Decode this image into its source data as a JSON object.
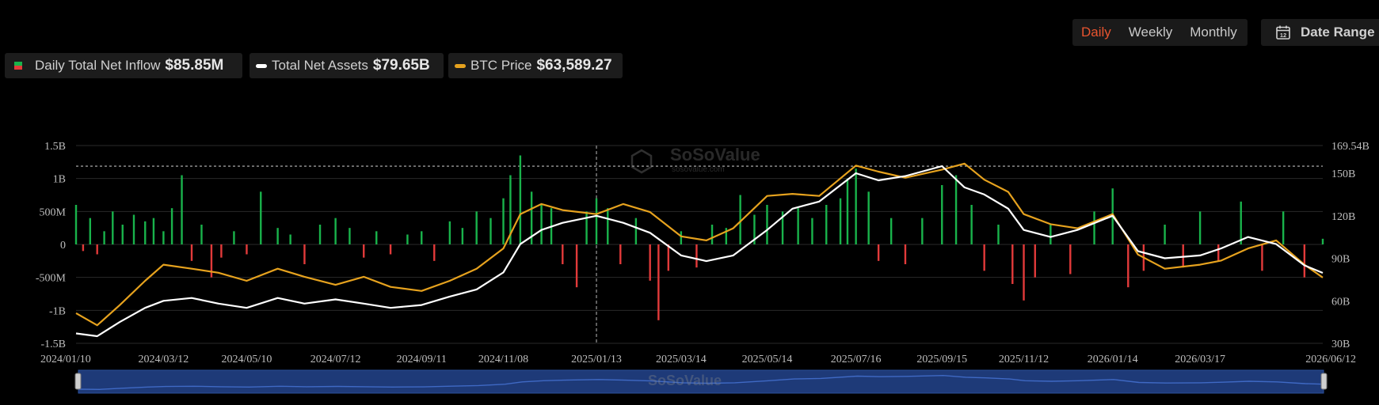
{
  "toolbar": {
    "period_options": [
      "Daily",
      "Weekly",
      "Monthly"
    ],
    "active_period": "Daily",
    "date_range_label": "Date Range",
    "date_range_icon": "calendar-icon"
  },
  "legend": {
    "inflow_label": "Daily Total Net Inflow",
    "inflow_value": "$85.85M",
    "assets_label": "Total Net Assets",
    "assets_value": "$79.65B",
    "btc_label": "BTC Price",
    "btc_value": "$63,589.27"
  },
  "watermark": {
    "text": "SoSoValue",
    "subtext": "sosovalue.com"
  },
  "colors": {
    "inflow_positive": "#19b34b",
    "inflow_negative": "#e23a3a",
    "assets_line": "#ffffff",
    "btc_line": "#e6a21e",
    "navigator": "#1e3a78",
    "active": "#e8542f"
  },
  "chart_data": {
    "type": "bar+line",
    "x_ticks": [
      "2024/01/10",
      "2024/03/12",
      "2024/05/10",
      "2024/07/12",
      "2024/09/11",
      "2024/11/08",
      "2025/01/13",
      "2025/03/14",
      "2025/05/14",
      "2025/07/16",
      "2025/09/15",
      "2025/11/12",
      "2026/01/14",
      "2026/03/17",
      "2026/06/12"
    ],
    "y_left_ticks": [
      "1.5B",
      "1B",
      "500M",
      "0",
      "-500M",
      "-1B",
      "-1.5B"
    ],
    "y_left_range": [
      -1500000000,
      1500000000
    ],
    "y_right_ticks": [
      "169.54B",
      "150B",
      "120B",
      "90B",
      "60B",
      "30B"
    ],
    "y_right_range": [
      30000000000,
      169540000000
    ],
    "crosshair_date": "2025/01/13",
    "reference_line": 155000000000,
    "series": [
      {
        "name": "Daily Total Net Inflow",
        "type": "bar",
        "x": [
          "2024/01/10",
          "2024/01/15",
          "2024/01/20",
          "2024/01/25",
          "2024/01/30",
          "2024/02/05",
          "2024/02/12",
          "2024/02/20",
          "2024/02/28",
          "2024/03/05",
          "2024/03/12",
          "2024/03/18",
          "2024/03/25",
          "2024/04/01",
          "2024/04/08",
          "2024/04/15",
          "2024/04/22",
          "2024/05/01",
          "2024/05/10",
          "2024/05/20",
          "2024/06/01",
          "2024/06/10",
          "2024/06/20",
          "2024/07/01",
          "2024/07/12",
          "2024/07/22",
          "2024/08/01",
          "2024/08/10",
          "2024/08/20",
          "2024/09/01",
          "2024/09/11",
          "2024/09/20",
          "2024/10/01",
          "2024/10/10",
          "2024/10/20",
          "2024/10/30",
          "2024/11/08",
          "2024/11/13",
          "2024/11/20",
          "2024/11/28",
          "2024/12/05",
          "2024/12/12",
          "2024/12/20",
          "2024/12/30",
          "2025/01/06",
          "2025/01/13",
          "2025/01/21",
          "2025/01/30",
          "2025/02/10",
          "2025/02/20",
          "2025/02/26",
          "2025/03/05",
          "2025/03/14",
          "2025/03/25",
          "2025/04/05",
          "2025/04/15",
          "2025/04/25",
          "2025/05/05",
          "2025/05/14",
          "2025/05/25",
          "2025/06/05",
          "2025/06/15",
          "2025/06/25",
          "2025/07/05",
          "2025/07/10",
          "2025/07/16",
          "2025/07/25",
          "2025/08/01",
          "2025/08/10",
          "2025/08/20",
          "2025/09/01",
          "2025/09/15",
          "2025/09/25",
          "2025/10/06",
          "2025/10/15",
          "2025/10/25",
          "2025/11/04",
          "2025/11/12",
          "2025/11/20",
          "2025/12/01",
          "2025/12/15",
          "2026/01/01",
          "2026/01/14",
          "2026/01/25",
          "2026/02/05",
          "2026/02/20",
          "2026/03/05",
          "2026/03/17",
          "2026/03/30",
          "2026/04/15",
          "2026/04/30",
          "2026/05/15",
          "2026/05/30",
          "2026/06/12"
        ],
        "values": [
          600000000,
          -100000000,
          400000000,
          -150000000,
          200000000,
          500000000,
          300000000,
          450000000,
          350000000,
          400000000,
          200000000,
          550000000,
          1050000000,
          -250000000,
          300000000,
          -500000000,
          -200000000,
          200000000,
          -150000000,
          800000000,
          250000000,
          150000000,
          -300000000,
          300000000,
          400000000,
          250000000,
          -200000000,
          200000000,
          -150000000,
          150000000,
          200000000,
          -250000000,
          350000000,
          250000000,
          500000000,
          400000000,
          700000000,
          1050000000,
          1350000000,
          800000000,
          600000000,
          550000000,
          -300000000,
          -650000000,
          500000000,
          700000000,
          550000000,
          -300000000,
          400000000,
          -550000000,
          -1150000000,
          -400000000,
          200000000,
          -350000000,
          300000000,
          250000000,
          750000000,
          450000000,
          600000000,
          500000000,
          550000000,
          400000000,
          600000000,
          700000000,
          1000000000,
          1150000000,
          800000000,
          -250000000,
          400000000,
          -300000000,
          400000000,
          900000000,
          1050000000,
          600000000,
          -400000000,
          300000000,
          -600000000,
          -850000000,
          -500000000,
          300000000,
          -450000000,
          500000000,
          850000000,
          -650000000,
          -400000000,
          300000000,
          -350000000,
          500000000,
          -250000000,
          650000000,
          -400000000,
          500000000,
          -500000000,
          85850000
        ]
      },
      {
        "name": "Total Net Assets",
        "type": "line",
        "x": [
          "2024/01/10",
          "2024/01/25",
          "2024/02/10",
          "2024/02/28",
          "2024/03/12",
          "2024/04/01",
          "2024/04/20",
          "2024/05/10",
          "2024/06/01",
          "2024/06/20",
          "2024/07/12",
          "2024/08/01",
          "2024/08/20",
          "2024/09/11",
          "2024/10/01",
          "2024/10/20",
          "2024/11/08",
          "2024/11/20",
          "2024/12/05",
          "2024/12/20",
          "2025/01/13",
          "2025/02/01",
          "2025/02/20",
          "2025/03/14",
          "2025/04/01",
          "2025/04/20",
          "2025/05/14",
          "2025/06/01",
          "2025/06/20",
          "2025/07/16",
          "2025/08/01",
          "2025/08/20",
          "2025/09/15",
          "2025/10/01",
          "2025/10/15",
          "2025/11/01",
          "2025/11/12",
          "2025/12/01",
          "2025/12/20",
          "2026/01/14",
          "2026/02/01",
          "2026/02/20",
          "2026/03/17",
          "2026/04/01",
          "2026/04/20",
          "2026/05/10",
          "2026/05/30",
          "2026/06/12"
        ],
        "values": [
          37000000000,
          35000000000,
          45000000000,
          55000000000,
          60000000000,
          62000000000,
          58000000000,
          55000000000,
          62000000000,
          58000000000,
          61000000000,
          58000000000,
          55000000000,
          57000000000,
          63000000000,
          68000000000,
          80000000000,
          100000000000,
          110000000000,
          115000000000,
          120000000000,
          115000000000,
          108000000000,
          92000000000,
          88000000000,
          92000000000,
          110000000000,
          125000000000,
          130000000000,
          150000000000,
          145000000000,
          148000000000,
          155000000000,
          140000000000,
          135000000000,
          125000000000,
          110000000000,
          105000000000,
          110000000000,
          120000000000,
          95000000000,
          90000000000,
          92000000000,
          97000000000,
          105000000000,
          100000000000,
          85000000000,
          79650000000
        ]
      },
      {
        "name": "BTC Price",
        "type": "line",
        "x": [
          "2024/01/10",
          "2024/01/25",
          "2024/02/10",
          "2024/02/28",
          "2024/03/12",
          "2024/04/01",
          "2024/04/20",
          "2024/05/10",
          "2024/06/01",
          "2024/06/20",
          "2024/07/12",
          "2024/08/01",
          "2024/08/20",
          "2024/09/11",
          "2024/10/01",
          "2024/10/20",
          "2024/11/08",
          "2024/11/20",
          "2024/12/05",
          "2024/12/20",
          "2025/01/13",
          "2025/02/01",
          "2025/02/20",
          "2025/03/14",
          "2025/04/01",
          "2025/04/20",
          "2025/05/14",
          "2025/06/01",
          "2025/06/20",
          "2025/07/16",
          "2025/08/01",
          "2025/08/20",
          "2025/09/15",
          "2025/10/01",
          "2025/10/15",
          "2025/11/01",
          "2025/11/12",
          "2025/12/01",
          "2025/12/20",
          "2026/01/14",
          "2026/02/01",
          "2026/02/20",
          "2026/03/17",
          "2026/04/01",
          "2026/04/20",
          "2026/05/10",
          "2026/05/30",
          "2026/06/12"
        ],
        "values": [
          46000,
          40000,
          50000,
          62000,
          70000,
          68000,
          66000,
          62000,
          68000,
          64000,
          60000,
          64000,
          59000,
          57000,
          62000,
          68000,
          78000,
          95000,
          100000,
          97000,
          95000,
          100000,
          96000,
          84000,
          82000,
          88000,
          104000,
          105000,
          104000,
          119000,
          116000,
          113000,
          117000,
          120000,
          112000,
          106000,
          95000,
          90000,
          88000,
          95000,
          75000,
          68000,
          70000,
          72000,
          78000,
          82000,
          70000,
          63589.27
        ]
      }
    ]
  }
}
